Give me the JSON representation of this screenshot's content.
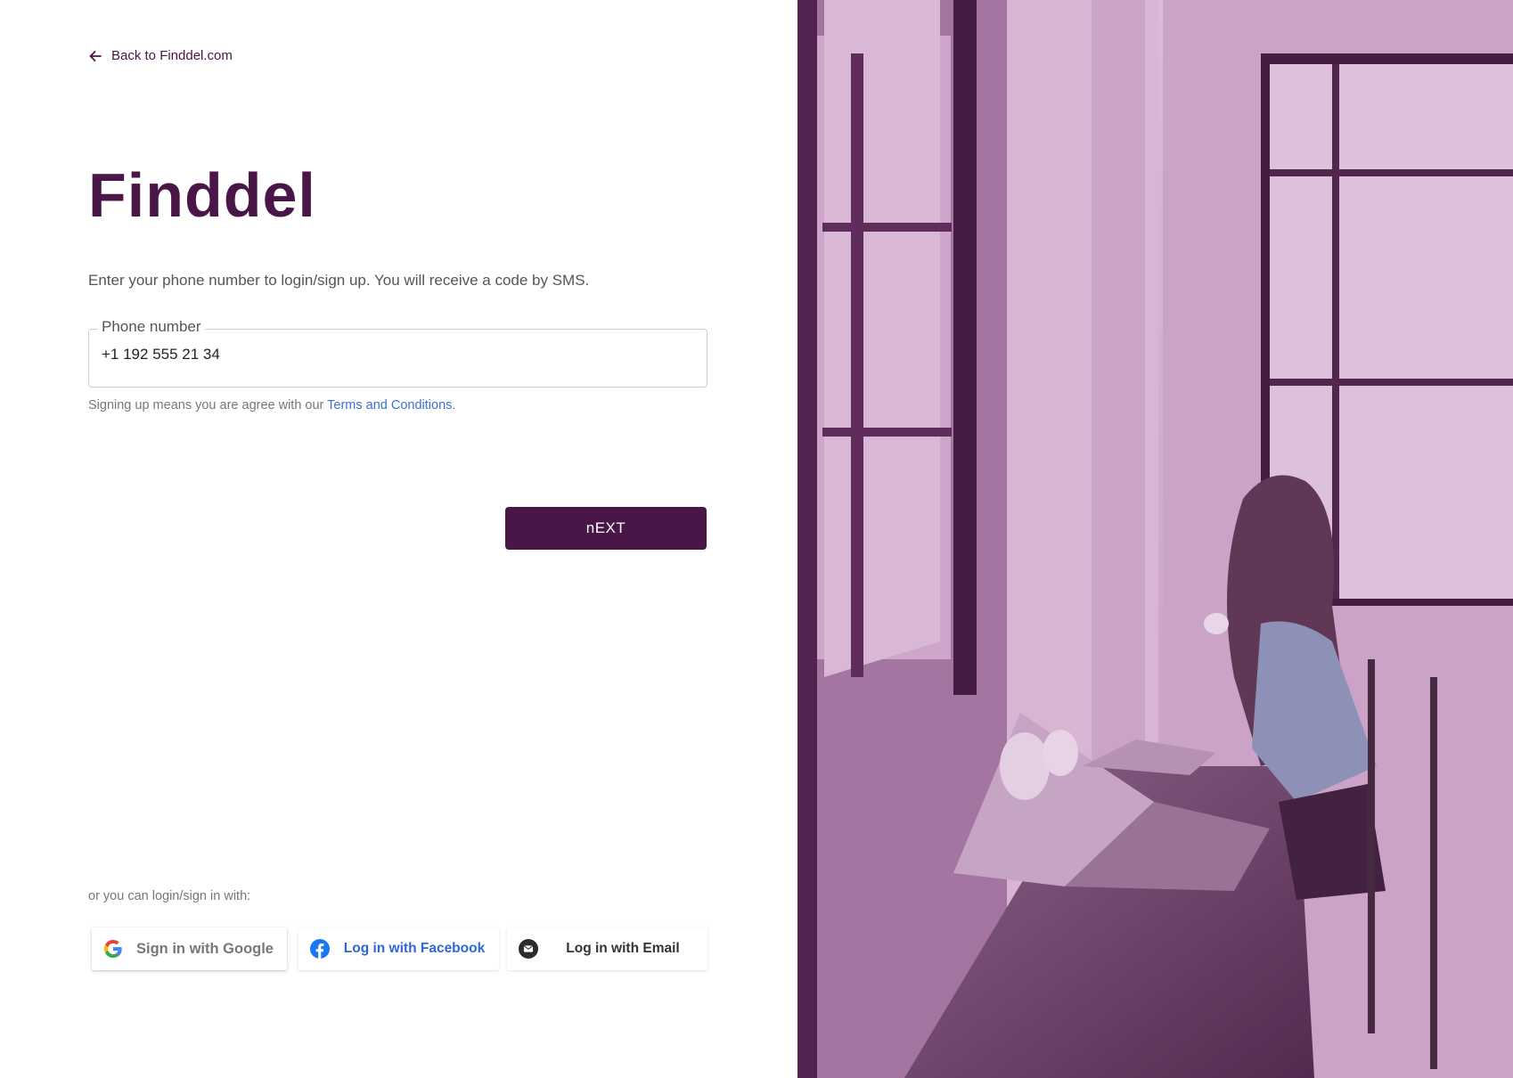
{
  "back_link": {
    "label": "Back to Finddel.com",
    "icon": "arrow-left-icon"
  },
  "logo": {
    "text": "Finddel"
  },
  "intro": "Enter your phone number to login/sign up. You will receive a code by SMS.",
  "phone_field": {
    "label": "Phone number",
    "value": "+1 192 555 21 34"
  },
  "terms": {
    "prefix": "Signing up means you are agree with our ",
    "link": "Terms and Conditions",
    "suffix": "."
  },
  "next_button": "nEXT",
  "alt_login": {
    "label": "or you can login/sign in with:",
    "google": {
      "label": "Sign in with Google",
      "icon": "google-icon"
    },
    "facebook": {
      "label": "Log in with Facebook",
      "icon": "facebook-icon"
    },
    "email": {
      "label": "Log in with Email",
      "icon": "email-icon"
    }
  },
  "colors": {
    "brand": "#4a1547",
    "link": "#3d6fd6",
    "photo_tint": "#d9bcd8"
  }
}
